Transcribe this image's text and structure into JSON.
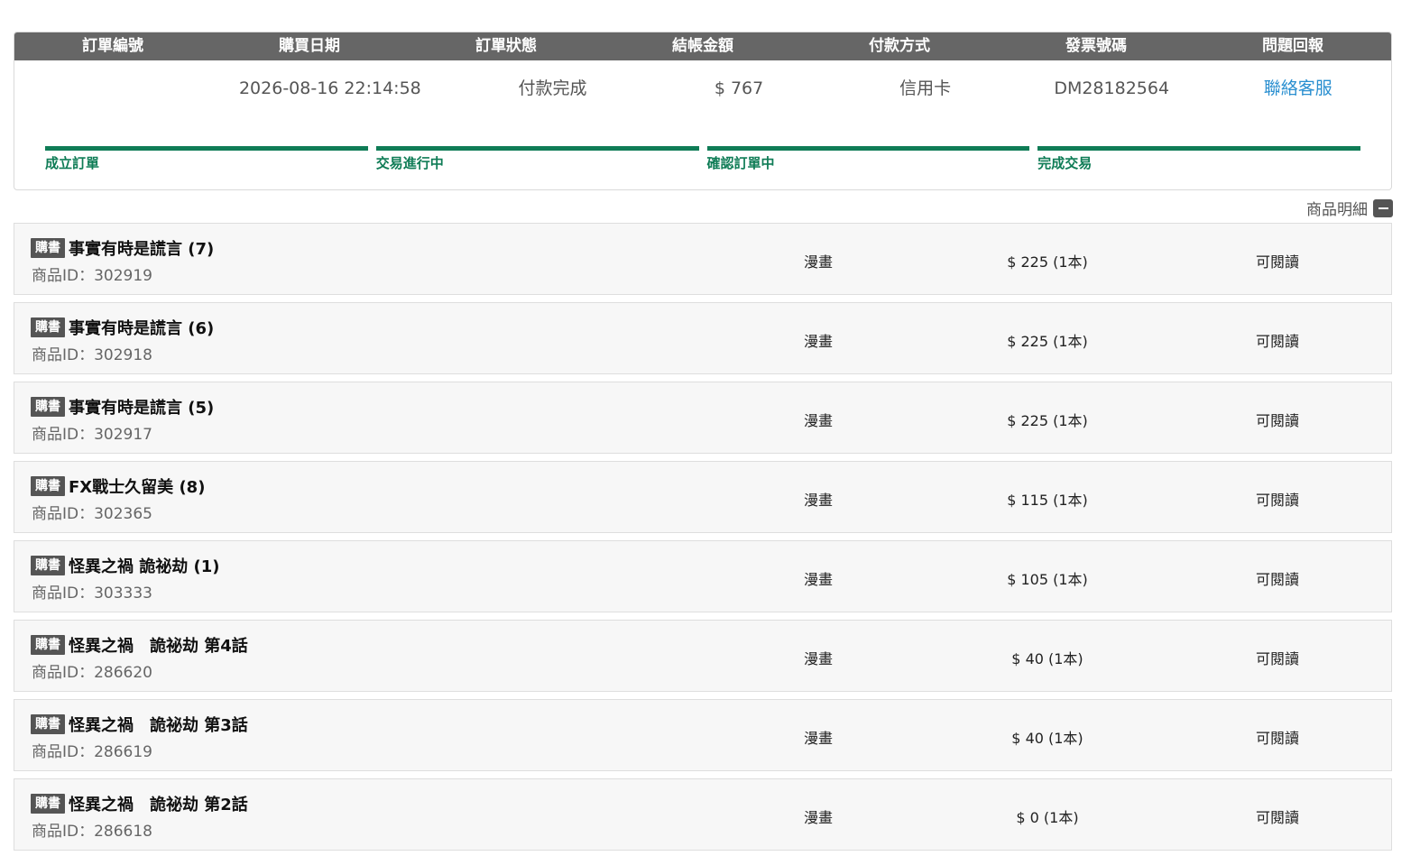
{
  "order": {
    "headers": [
      "訂單編號",
      "購買日期",
      "訂單狀態",
      "結帳金額",
      "付款方式",
      "發票號碼",
      "問題回報"
    ],
    "order_id": "",
    "date": "2026-08-16 22:14:58",
    "status": "付款完成",
    "amount": "$ 767",
    "payment": "信用卡",
    "invoice": "DM28182564",
    "report_link": "聯絡客服"
  },
  "progress": {
    "steps": [
      "成立訂單",
      "交易進行中",
      "確認訂單中",
      "完成交易"
    ],
    "color": "#0f7c56"
  },
  "detail_toggle": {
    "label": "商品明細",
    "icon": "minus-icon"
  },
  "items": [
    {
      "badge": "購書",
      "title": "事實有時是謊言 (7)",
      "pid": "商品ID：302919",
      "category": "漫畫",
      "price": "$ 225 (1本)",
      "action": "可閱讀"
    },
    {
      "badge": "購書",
      "title": "事實有時是謊言 (6)",
      "pid": "商品ID：302918",
      "category": "漫畫",
      "price": "$ 225 (1本)",
      "action": "可閱讀"
    },
    {
      "badge": "購書",
      "title": "事實有時是謊言 (5)",
      "pid": "商品ID：302917",
      "category": "漫畫",
      "price": "$ 225 (1本)",
      "action": "可閱讀"
    },
    {
      "badge": "購書",
      "title": "FX戰士久留美 (8)",
      "pid": "商品ID：302365",
      "category": "漫畫",
      "price": "$ 115 (1本)",
      "action": "可閱讀"
    },
    {
      "badge": "購書",
      "title": "怪異之禍 詭祕劫 (1)",
      "pid": "商品ID：303333",
      "category": "漫畫",
      "price": "$ 105 (1本)",
      "action": "可閱讀"
    },
    {
      "badge": "購書",
      "title": "怪異之禍　詭祕劫 第4話",
      "pid": "商品ID：286620",
      "category": "漫畫",
      "price": "$ 40 (1本)",
      "action": "可閱讀"
    },
    {
      "badge": "購書",
      "title": "怪異之禍　詭祕劫 第3話",
      "pid": "商品ID：286619",
      "category": "漫畫",
      "price": "$ 40 (1本)",
      "action": "可閱讀"
    },
    {
      "badge": "購書",
      "title": "怪異之禍　詭祕劫 第2話",
      "pid": "商品ID：286618",
      "category": "漫畫",
      "price": "$ 0 (1本)",
      "action": "可閱讀"
    }
  ]
}
